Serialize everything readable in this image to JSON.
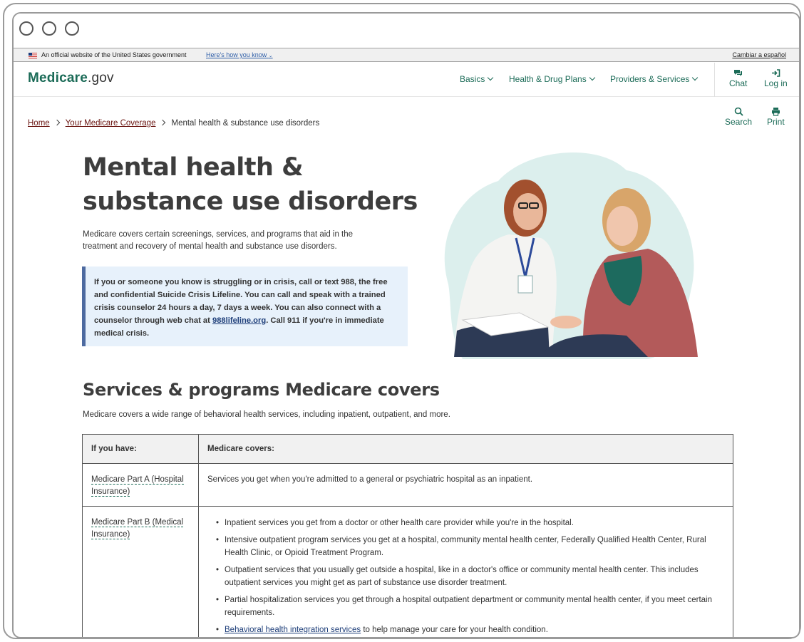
{
  "gov_banner": {
    "official_text": "An official website of the United States government",
    "how_link": "Here's how you know",
    "spanish_link": "Cambiar a español"
  },
  "header": {
    "logo_main": "Medicare",
    "logo_suffix": ".gov",
    "nav": [
      "Basics",
      "Health & Drug Plans",
      "Providers & Services"
    ],
    "chat_label": "Chat",
    "login_label": "Log in"
  },
  "breadcrumb": {
    "home": "Home",
    "coverage": "Your Medicare Coverage",
    "current": "Mental health & substance use disorders"
  },
  "tools": {
    "search_label": "Search",
    "print_label": "Print"
  },
  "page": {
    "title": "Mental health & substance use disorders",
    "intro": "Medicare covers certain screenings, services, and programs that aid in the treatment and recovery of mental health and substance use disorders.",
    "callout_text_1": "If you or someone you know is struggling or in crisis, call or text 988, the free and confidential Suicide Crisis Lifeline. You can call and speak with a trained crisis counselor 24 hours a day, 7 days a week. You can also connect with a counselor through web chat at ",
    "callout_link": "988lifeline.org",
    "callout_text_2": ". Call 911 if you're in immediate medical crisis."
  },
  "services": {
    "heading": "Services & programs Medicare covers",
    "description": "Medicare covers a wide range of behavioral health services, including inpatient, outpatient, and more.",
    "table": {
      "col1_header": "If you have:",
      "col2_header": "Medicare covers:",
      "row1_term": "Medicare Part A (Hospital Insurance)",
      "row1_text": "Services you get when you're admitted to a general or psychiatric hospital as an inpatient.",
      "row2_term": "Medicare Part B (Medical Insurance)",
      "row2_items": [
        "Inpatient services you get from a doctor or other health care provider while you're in the hospital.",
        "Intensive outpatient program services you get at a hospital, community mental health center, Federally Qualified Health Center, Rural Health Clinic, or Opioid Treatment Program.",
        "Outpatient services that you usually get outside a hospital, like in a doctor's office or community mental health center. This includes outpatient services you might get as part of substance use disorder treatment.",
        "Partial hospitalization services you get through a hospital outpatient department or community mental health center, if you meet certain requirements."
      ],
      "row2_link": "Behavioral health integration services",
      "row2_link_tail": " to help manage your care for your health condition."
    }
  },
  "colors": {
    "brand_green": "#1b6b57",
    "link_red": "#6a1410",
    "callout_bg": "#e7f1fb",
    "callout_border": "#4d6aa0"
  }
}
